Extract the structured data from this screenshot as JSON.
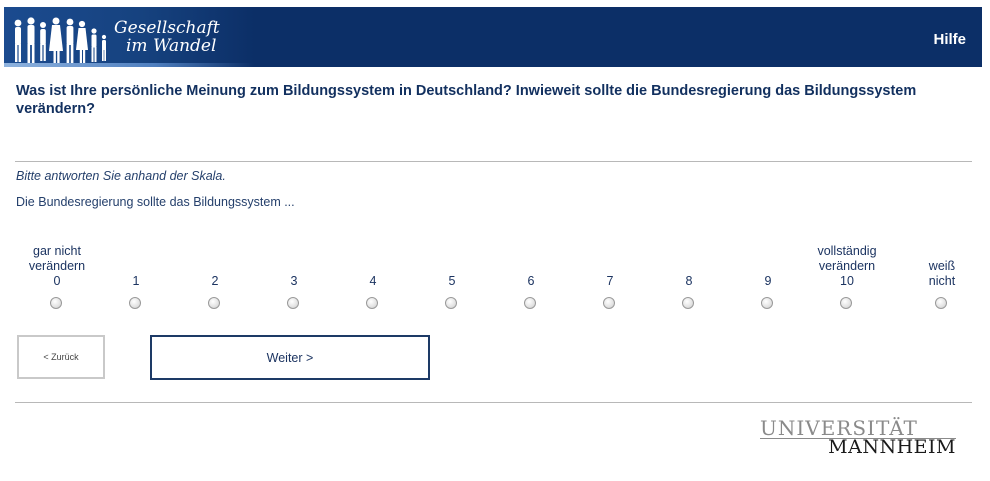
{
  "header": {
    "brand_line1": "Gesellschaft",
    "brand_line2": "im Wandel",
    "help_label": "Hilfe",
    "color": "#0c2f67"
  },
  "question": {
    "text": "Was ist Ihre persönliche Meinung zum Bildungssystem in Deutschland? Inwieweit sollte die Bundesregierung das Bildungssystem verändern?",
    "instruction": "Bitte antworten Sie anhand der Skala.",
    "stem": "Die Bundesregierung sollte das Bildungssystem ..."
  },
  "scale": {
    "options": [
      {
        "label": "gar nicht verändern 0",
        "line1": "gar nicht",
        "line2": "verändern",
        "line3": "0",
        "selected": false
      },
      {
        "label": "1",
        "line1": "",
        "line2": "",
        "line3": "1",
        "selected": false
      },
      {
        "label": "2",
        "line1": "",
        "line2": "",
        "line3": "2",
        "selected": false
      },
      {
        "label": "3",
        "line1": "",
        "line2": "",
        "line3": "3",
        "selected": false
      },
      {
        "label": "4",
        "line1": "",
        "line2": "",
        "line3": "4",
        "selected": false
      },
      {
        "label": "5",
        "line1": "",
        "line2": "",
        "line3": "5",
        "selected": false
      },
      {
        "label": "6",
        "line1": "",
        "line2": "",
        "line3": "6",
        "selected": false
      },
      {
        "label": "7",
        "line1": "",
        "line2": "",
        "line3": "7",
        "selected": false
      },
      {
        "label": "8",
        "line1": "",
        "line2": "",
        "line3": "8",
        "selected": false
      },
      {
        "label": "9",
        "line1": "",
        "line2": "",
        "line3": "9",
        "selected": false
      },
      {
        "label": "vollständig verändern 10",
        "line1": "vollständig",
        "line2": "verändern",
        "line3": "10",
        "selected": false
      },
      {
        "label": "weiß nicht",
        "line1": "",
        "line2": "weiß",
        "line3": "nicht",
        "selected": false
      }
    ]
  },
  "nav": {
    "back_label": "< Zurück",
    "next_label": "Weiter >"
  },
  "footer": {
    "logo_line1": "UNIVERSITÄT",
    "logo_line2": "MANNHEIM"
  }
}
